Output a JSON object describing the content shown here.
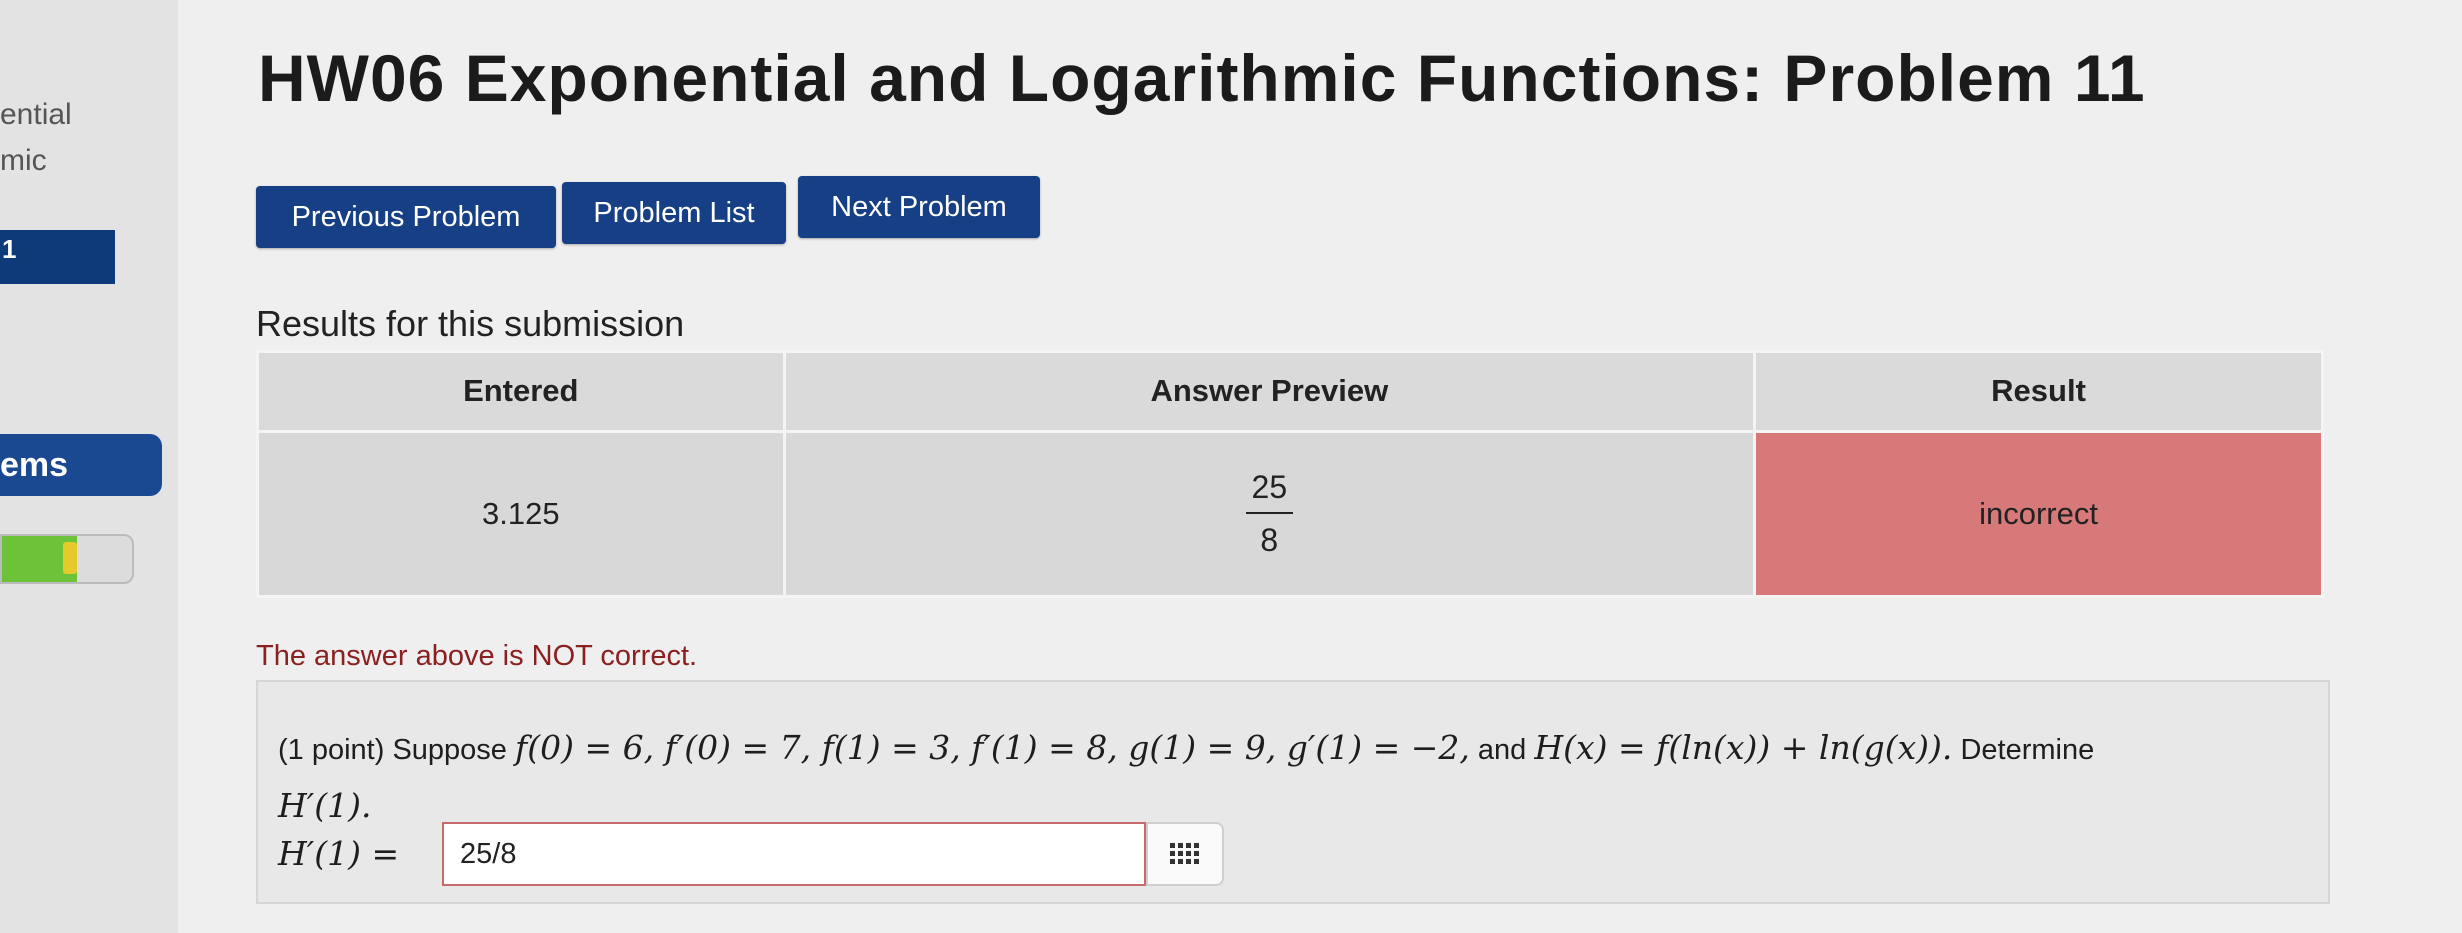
{
  "sidebar": {
    "partial_text_1": "ential",
    "partial_text_2": "mic",
    "partial_text_3": "1",
    "partial_text_4": "ems",
    "progress_fraction": 0.58,
    "colors": {
      "nav_active": "#1a4891",
      "progress_fill": "#6cc33a",
      "progress_tip": "#e6c92a"
    }
  },
  "page_title": "HW06 Exponential and Logarithmic Functions: Problem 11",
  "nav_buttons": {
    "previous": "Previous Problem",
    "list": "Problem List",
    "next": "Next Problem",
    "color": "#173f86"
  },
  "results": {
    "heading": "Results for this submission",
    "columns": [
      "Entered",
      "Answer Preview",
      "Result"
    ],
    "row": {
      "entered": "3.125",
      "preview_numerator": "25",
      "preview_denominator": "8",
      "result": "incorrect",
      "result_color": "#d87979"
    }
  },
  "feedback": "The answer above is NOT correct.",
  "problem": {
    "points": "(1 point) Suppose",
    "given": "f(0) = 6, f′(0) = 7, f(1) = 3, f′(1) = 8, g(1) = 9, g′(1) = −2,",
    "and_word": "and",
    "definition": "H(x) = f(ln(x)) + ln(g(x)).",
    "determine_word": "Determine",
    "target": "H′(1).",
    "answer_label": "H′(1) =",
    "answer_value": "25/8",
    "tool_icon": "equation-grid-icon"
  }
}
